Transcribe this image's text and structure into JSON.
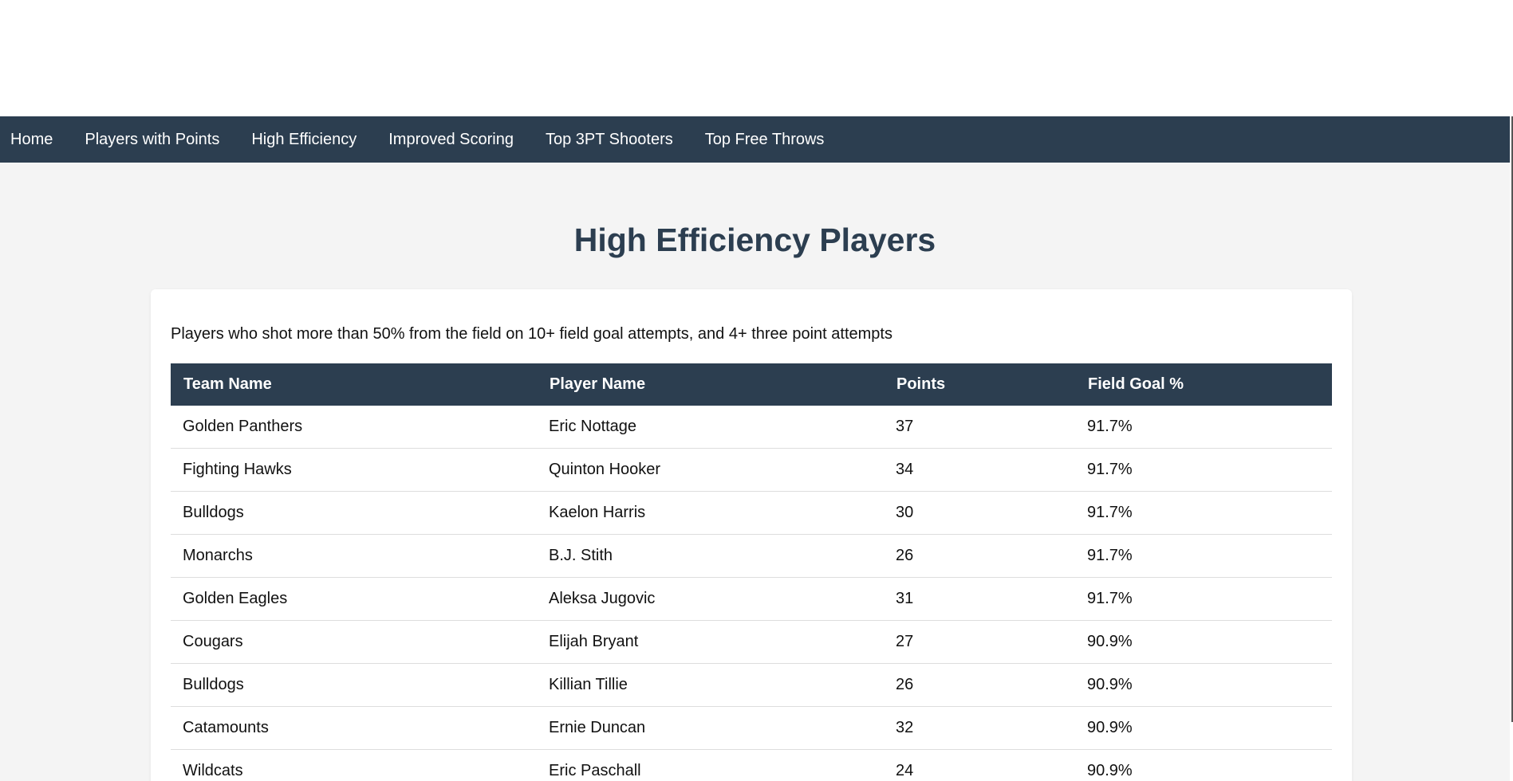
{
  "nav": {
    "items": [
      {
        "label": "Home"
      },
      {
        "label": "Players with Points"
      },
      {
        "label": "High Efficiency"
      },
      {
        "label": "Improved Scoring"
      },
      {
        "label": "Top 3PT Shooters"
      },
      {
        "label": "Top Free Throws"
      }
    ]
  },
  "page": {
    "title": "High Efficiency Players",
    "description": "Players who shot more than 50% from the field on 10+ field goal attempts, and 4+ three point attempts"
  },
  "table": {
    "headers": [
      "Team Name",
      "Player Name",
      "Points",
      "Field Goal %"
    ],
    "rows": [
      [
        "Golden Panthers",
        "Eric Nottage",
        "37",
        "91.7%"
      ],
      [
        "Fighting Hawks",
        "Quinton Hooker",
        "34",
        "91.7%"
      ],
      [
        "Bulldogs",
        "Kaelon Harris",
        "30",
        "91.7%"
      ],
      [
        "Monarchs",
        "B.J. Stith",
        "26",
        "91.7%"
      ],
      [
        "Golden Eagles",
        "Aleksa Jugovic",
        "31",
        "91.7%"
      ],
      [
        "Cougars",
        "Elijah Bryant",
        "27",
        "90.9%"
      ],
      [
        "Bulldogs",
        "Killian Tillie",
        "26",
        "90.9%"
      ],
      [
        "Catamounts",
        "Ernie Duncan",
        "32",
        "90.9%"
      ],
      [
        "Wildcats",
        "Eric Paschall",
        "24",
        "90.9%"
      ]
    ]
  },
  "colors": {
    "nav_bg": "#2c3e50",
    "title": "#2c3e50",
    "page_bg": "#f4f4f4",
    "header_bg": "#2c3e50"
  }
}
